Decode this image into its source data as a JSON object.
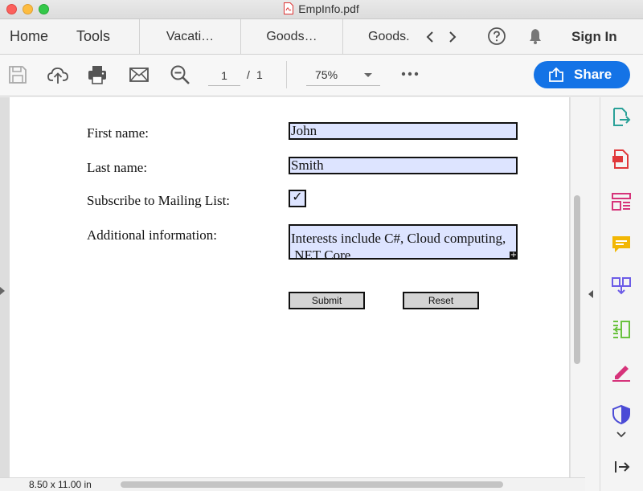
{
  "window": {
    "title": "EmpInfo.pdf"
  },
  "tabbar": {
    "home": "Home",
    "tools": "Tools",
    "tabs": [
      "Vacati…",
      "Goods…",
      "Goods."
    ],
    "sign_in": "Sign In"
  },
  "toolbar": {
    "page_current": "1",
    "page_separator": "/",
    "page_total": "1",
    "zoom": "75%",
    "share": "Share"
  },
  "form": {
    "first_name_label": "First name:",
    "first_name_value": "John",
    "last_name_label": "Last name:",
    "last_name_value": "Smith",
    "subscribe_label": "Subscribe to Mailing List:",
    "subscribe_mark": "✓",
    "additional_label": "Additional information:",
    "additional_value": "Interests include C#, Cloud computing, .NET Core",
    "submit": "Submit",
    "reset": "Reset"
  },
  "status": {
    "page_size": "8.50 x 11.00 in"
  },
  "colors": {
    "accent": "#1473e6",
    "field_fill": "#dde4ff",
    "page_bg": "#ffffff"
  },
  "rail_icons": [
    "export-pdf-icon",
    "create-pdf-icon",
    "organize-pages-icon",
    "comment-icon",
    "combine-files-icon",
    "compress-pdf-icon",
    "fill-sign-icon",
    "protect-icon"
  ]
}
